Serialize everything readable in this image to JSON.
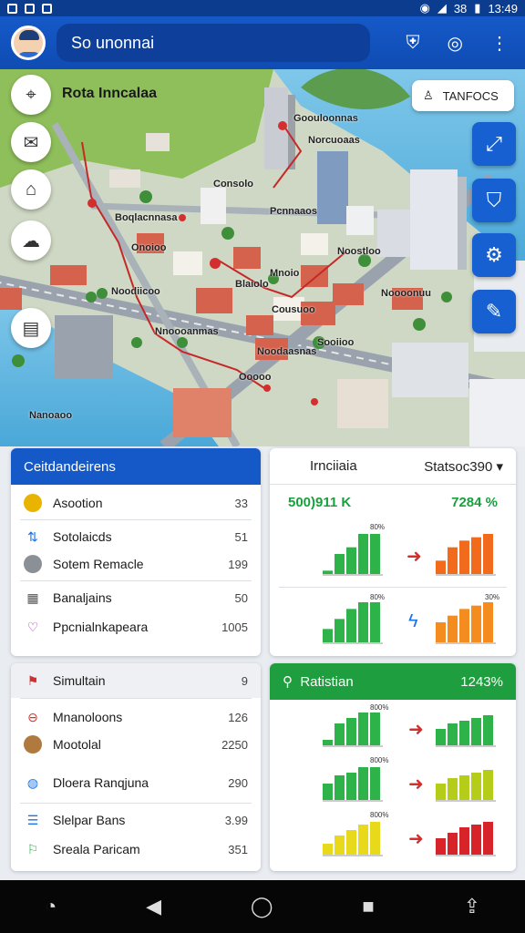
{
  "status_bar": {
    "time": "13:49",
    "signal": "38"
  },
  "app_bar": {
    "search_text": "So unonnai",
    "avatar": "user-avatar",
    "icons": [
      "shield-icon",
      "compass-icon",
      "more-vert-icon"
    ]
  },
  "map": {
    "title": "Rota Inncalaa",
    "chip_label": "TANFOCS",
    "left_tools": [
      "location-icon",
      "mail-icon",
      "bookmark-icon",
      "layers-icon",
      "clipboard-icon"
    ],
    "right_tools": [
      "map-expand-icon",
      "shield-icon",
      "settings-icon",
      "edit-icon"
    ],
    "labels": [
      {
        "text": "Goouloonnas"
      },
      {
        "text": "Norcuoaas"
      },
      {
        "text": "Consolo"
      },
      {
        "text": "Boqlacnnasa"
      },
      {
        "text": "Pcnnaaos"
      },
      {
        "text": "Onoioo"
      },
      {
        "text": "Noostloo"
      },
      {
        "text": "Mnoio"
      },
      {
        "text": "Noodiicoo"
      },
      {
        "text": "Blaiolo"
      },
      {
        "text": "Nnoooanmas"
      },
      {
        "text": "Cousuoo"
      },
      {
        "text": "Noooonuu"
      },
      {
        "text": "Noodaasnas"
      },
      {
        "text": "Sooiioo"
      },
      {
        "text": "Nanoaoo"
      },
      {
        "text": "Ooooo"
      }
    ]
  },
  "panel1": {
    "header": "Ceitdandeirens",
    "rows": [
      {
        "label": "Asootion",
        "value": "33",
        "icon": "coin-icon",
        "color": "#e8b400"
      },
      {
        "label": "Sotolaicds",
        "value": "51",
        "icon": "route-icon",
        "color": "#1a73e8"
      },
      {
        "label": "Sotem Remacle",
        "value": "199",
        "icon": "image-icon",
        "color": "#6b6b6b"
      },
      {
        "label": "Banaljains",
        "value": "50",
        "icon": "stack-icon",
        "color": "#555"
      },
      {
        "label": "Ppcnialnkapeara",
        "value": "1005",
        "icon": "heart-icon",
        "color": "#a12bb0"
      }
    ]
  },
  "panel2": {
    "header_left": "Irnciiaia",
    "header_right": "Statsoc390",
    "left_value": "500)911 K",
    "right_value": "7284 %",
    "chart_rows": [
      {
        "left_top": "80%",
        "right_top": "",
        "arrow": "arrow-right-icon",
        "left_colors": "#2db34a",
        "right_colors": "#f26a1b",
        "left": [
          5,
          30,
          40,
          60,
          60
        ],
        "right": [
          20,
          40,
          50,
          55,
          60
        ]
      },
      {
        "left_top": "80%",
        "right_top": "30%",
        "arrow": "lightning-icon",
        "left_colors": "#2db34a",
        "right_colors": "#f58c1f",
        "left": [
          20,
          35,
          50,
          60,
          60
        ],
        "right": [
          30,
          40,
          50,
          55,
          60
        ]
      }
    ]
  },
  "panel3": {
    "header": "Simultain",
    "header_value": "9",
    "rows": [
      {
        "label": "Mnanoloons",
        "value": "126",
        "icon": "alert-icon",
        "color": "#d93025"
      },
      {
        "label": "Mootolal",
        "value": "2250",
        "icon": "person-icon",
        "color": "#b07a3e"
      },
      {
        "label": "Dloera Ranqjuna",
        "value": "290",
        "icon": "globe-icon",
        "color": "#1a73e8"
      },
      {
        "label": "Slelpar Bans",
        "value": "3.99",
        "icon": "list-icon",
        "color": "#1a73e8"
      },
      {
        "label": "Sreala Paricam",
        "value": "351",
        "icon": "flag-icon",
        "color": "#2db34a"
      }
    ]
  },
  "panel4": {
    "header": "Ratistian",
    "header_value": "1243%",
    "chart_rows": [
      {
        "left_top": "800%",
        "right_top": "",
        "left_color": "#2db34a",
        "right_color": "#2db34a",
        "left": [
          10,
          40,
          50,
          60,
          60
        ],
        "right": [
          30,
          40,
          45,
          50,
          55
        ]
      },
      {
        "left_top": "800%",
        "right_top": "",
        "left_color": "#2db34a",
        "right_color": "#b5cc18",
        "left": [
          30,
          45,
          50,
          60,
          60
        ],
        "right": [
          30,
          40,
          45,
          50,
          55
        ]
      },
      {
        "left_top": "800%",
        "right_top": "",
        "left_color": "#e8d91a",
        "right_color": "#d6242a",
        "left": [
          20,
          35,
          45,
          55,
          60
        ],
        "right": [
          30,
          40,
          50,
          55,
          60
        ]
      }
    ]
  },
  "nav": [
    "timer-icon",
    "back-icon",
    "home-icon",
    "recent-icon",
    "share-icon"
  ]
}
